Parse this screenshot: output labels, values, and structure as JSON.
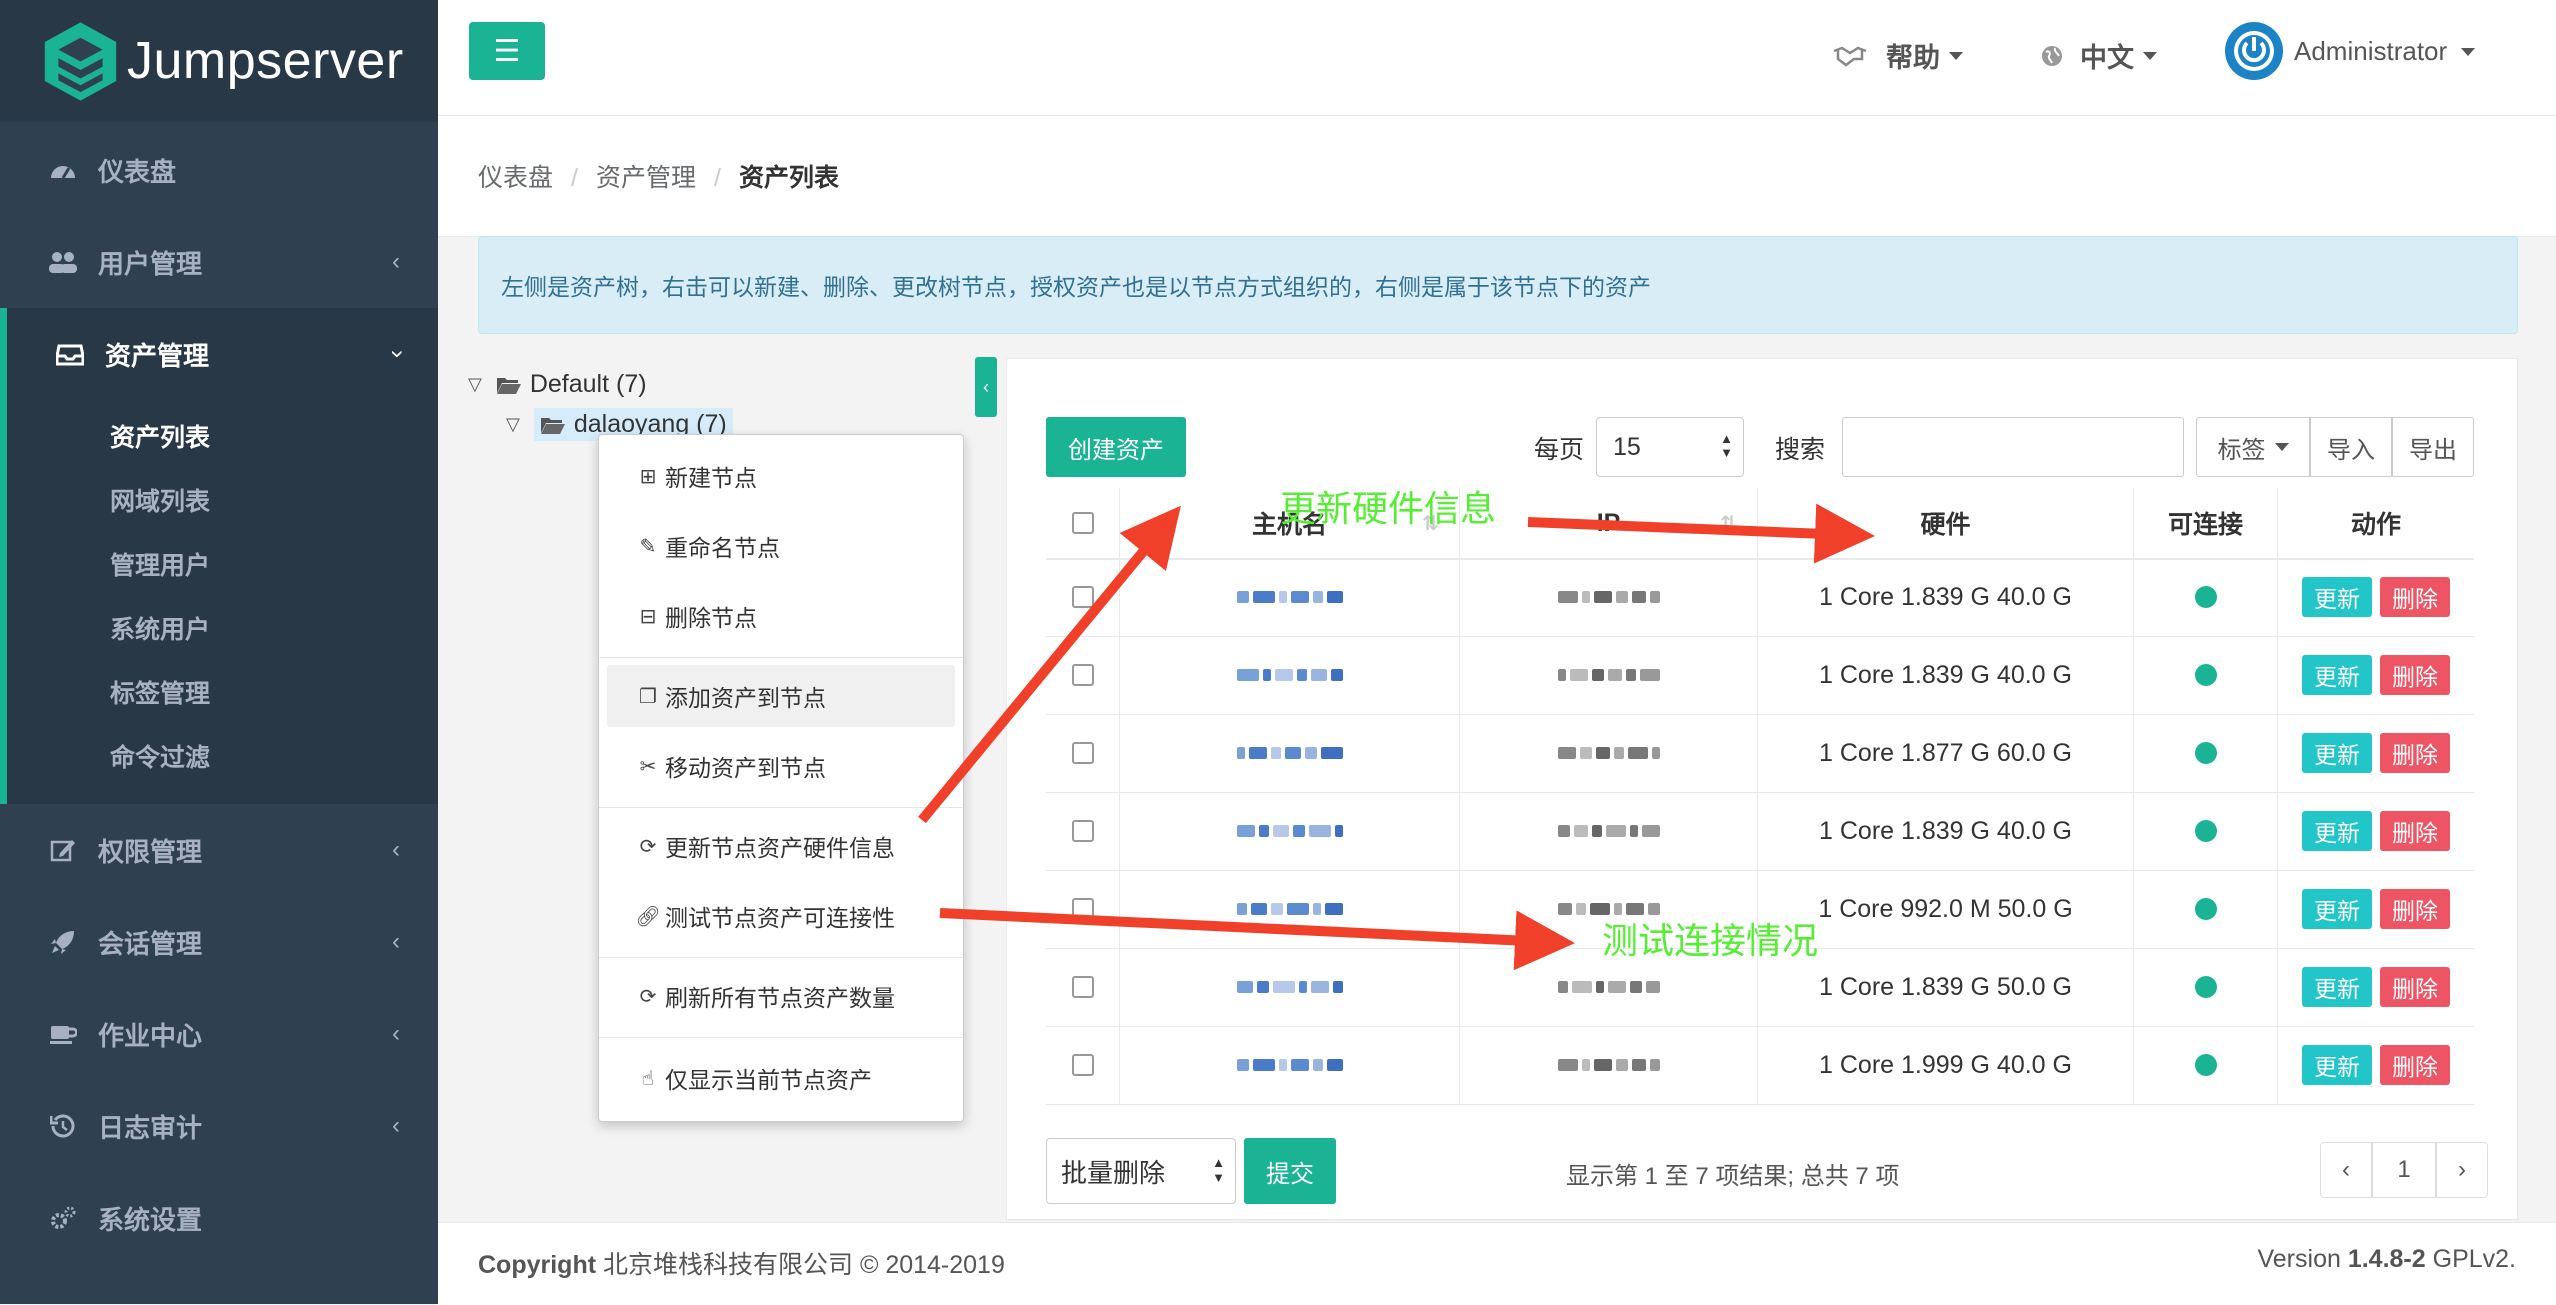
{
  "app": {
    "brand": "Jumpserver"
  },
  "sidebar": {
    "items": [
      {
        "label": "仪表盘",
        "icon": "dashboard-icon"
      },
      {
        "label": "用户管理",
        "icon": "users-icon"
      },
      {
        "label": "资产管理",
        "icon": "inbox-icon"
      },
      {
        "label": "权限管理",
        "icon": "edit-icon"
      },
      {
        "label": "会话管理",
        "icon": "rocket-icon"
      },
      {
        "label": "作业中心",
        "icon": "coffee-icon"
      },
      {
        "label": "日志审计",
        "icon": "history-icon"
      },
      {
        "label": "系统设置",
        "icon": "gears-icon"
      }
    ],
    "asset_sub": [
      "资产列表",
      "网域列表",
      "管理用户",
      "系统用户",
      "标签管理",
      "命令过滤"
    ]
  },
  "topbar": {
    "help": "帮助",
    "language": "中文",
    "user": "Administrator"
  },
  "breadcrumb": {
    "home": "仪表盘",
    "section": "资产管理",
    "current": "资产列表"
  },
  "info": "左侧是资产树，右击可以新建、删除、更改树节点，授权资产也是以节点方式组织的，右侧是属于该节点下的资产",
  "tree": {
    "root": "Default (7)",
    "child": "dalaoyang (7)"
  },
  "context_menu": [
    "新建节点",
    "重命名节点",
    "删除节点",
    "添加资产到节点",
    "移动资产到节点",
    "更新节点资产硬件信息",
    "测试节点资产可连接性",
    "刷新所有节点资产数量",
    "仅显示当前节点资产"
  ],
  "toolbar": {
    "create": "创建资产",
    "per_page_label": "每页",
    "per_page_value": "15",
    "search_label": "搜索",
    "labels": "标签",
    "import": "导入",
    "export": "导出"
  },
  "table": {
    "headers": {
      "hostname": "主机名",
      "ip": "IP",
      "hardware": "硬件",
      "connectable": "可连接",
      "actions": "动作"
    },
    "update_label": "更新",
    "delete_label": "删除",
    "rows": [
      {
        "hardware": "1 Core 1.839 G 40.0 G"
      },
      {
        "hardware": "1 Core 1.839 G 40.0 G"
      },
      {
        "hardware": "1 Core 1.877 G 60.0 G"
      },
      {
        "hardware": "1 Core 1.839 G 40.0 G"
      },
      {
        "hardware": "1 Core 992.0 M 50.0 G"
      },
      {
        "hardware": "1 Core 1.839 G 50.0 G"
      },
      {
        "hardware": "1 Core 1.999 G 40.0 G"
      }
    ]
  },
  "bottom": {
    "bulk_action": "批量删除",
    "submit": "提交",
    "summary": "显示第 1 至 7 项结果; 总共 7 项",
    "pager": {
      "prev": "‹",
      "page": "1",
      "next": "›"
    }
  },
  "footer": {
    "copyright_label": "Copyright",
    "copyright_text": "北京堆栈科技有限公司 © 2014-2019",
    "version_label": "Version",
    "version": "1.4.8-2",
    "license": "GPLv2."
  },
  "annotations": {
    "hardware": "更新硬件信息",
    "connectivity": "测试连接情况"
  },
  "colors": {
    "sidebar": "#2f4050",
    "accent": "#1ab394",
    "info_btn": "#23c6c8",
    "danger": "#ed5565",
    "annotation_text": "#55ee33",
    "arrow": "#f0402a"
  }
}
